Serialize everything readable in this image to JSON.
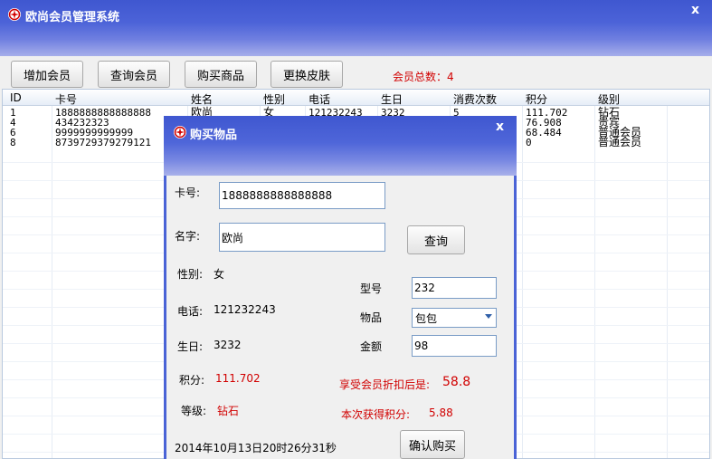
{
  "main": {
    "title": "欧尚会员管理系统",
    "close": "x",
    "toolbar": {
      "add_member": "增加会员",
      "query_member": "查询会员",
      "buy_goods": "购买商品",
      "change_skin": "更换皮肤",
      "member_count_label": "会员总数：4"
    },
    "grid": {
      "headers": [
        "ID",
        "卡号",
        "姓名",
        "性别",
        "电话",
        "生日",
        "消费次数",
        "积分",
        "级别"
      ],
      "rows": [
        {
          "id": "1",
          "card": "1888888888888888",
          "name": "欧尚",
          "gender": "女",
          "phone": "121232243",
          "birthday": "3232",
          "visits": "5",
          "points": "111.702",
          "level": "钻石"
        },
        {
          "id": "4",
          "card": "434232323",
          "name": "",
          "gender": "",
          "phone": "",
          "birthday": "",
          "visits": "",
          "points": "76.908",
          "level": "贵宾"
        },
        {
          "id": "6",
          "card": "9999999999999",
          "name": "",
          "gender": "",
          "phone": "",
          "birthday": "",
          "visits": "",
          "points": "68.484",
          "level": "普通会员"
        },
        {
          "id": "8",
          "card": "8739729379279121",
          "name": "",
          "gender": "",
          "phone": "",
          "birthday": "",
          "visits": "",
          "points": "0",
          "level": "普通会员"
        }
      ]
    }
  },
  "dialog": {
    "title": "购买物品",
    "close": "x",
    "card_label": "卡号:",
    "card_value": "1888888888888888",
    "name_label": "名字:",
    "name_value": "欧尚",
    "query_button": "查询",
    "gender_label": "性别:",
    "gender_value": "女",
    "phone_label": "电话:",
    "phone_value": "121232243",
    "birthday_label": "生日:",
    "birthday_value": "3232",
    "points_label": "积分:",
    "points_value": "111.702",
    "level_label": "等级:",
    "level_value": "钻石",
    "model_label": "型号",
    "model_value": "232",
    "item_label": "物品",
    "item_value": "包包",
    "amount_label": "金额",
    "amount_value": "98",
    "discount_label": "享受会员折扣后是:",
    "discount_value": "58.8",
    "earned_label": "本次获得积分:",
    "earned_value": "5.88",
    "datetime": "2014年10月13日20时26分31秒",
    "confirm_button": "确认购买"
  },
  "colors": {
    "titlebar": "#4c63d8",
    "accent_red": "#d10000",
    "input_border": "#7a9cc6"
  },
  "icons": {
    "app": "flower-logo-icon",
    "close": "close-icon",
    "dropdown": "chevron-down-icon"
  }
}
